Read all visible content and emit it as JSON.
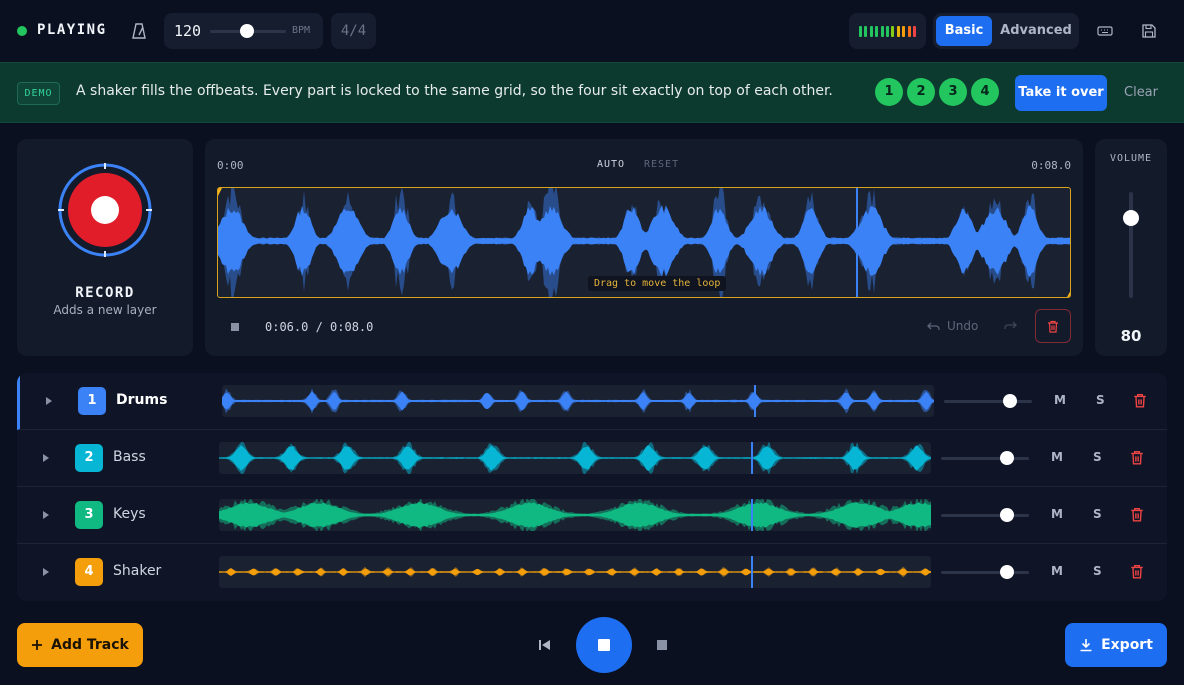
{
  "app": {
    "status": "PLAYING",
    "bpm": "120",
    "bpm_unit": "BPM",
    "bpm_value": 120,
    "time_signature": "4/4",
    "modes": {
      "basic": "Basic",
      "advanced": "Advanced",
      "selected": "basic"
    }
  },
  "demo": {
    "tag": "DEMO",
    "message": "A shaker fills the offbeats. Every part is locked to the same grid, so the four sit exactly on top of each other.",
    "steps": [
      "1",
      "2",
      "3",
      "4"
    ],
    "take_over_label": "Take it over",
    "clear_label": "Clear"
  },
  "recorder": {
    "title": "RECORD",
    "subtitle": "Adds a new layer"
  },
  "loop": {
    "start_time": "0:00",
    "end_time": "0:08.0",
    "auto_label": "AUTO",
    "reset_label": "RESET",
    "hint": "Drag to move the loop",
    "position_text": "0:06.0 / 0:08.0",
    "undo_label": "Undo",
    "playhead_fraction": 0.75
  },
  "volume": {
    "label": "VOLUME",
    "value": "80",
    "level": 0.8
  },
  "tracks": [
    {
      "number": "1",
      "name": "Drums",
      "color": "#3b82f6",
      "selected": true,
      "mute": "M",
      "solo": "S",
      "volume": 0.8
    },
    {
      "number": "2",
      "name": "Bass",
      "color": "#06b6d4",
      "selected": false,
      "mute": "M",
      "solo": "S",
      "volume": 0.8
    },
    {
      "number": "3",
      "name": "Keys",
      "color": "#10b981",
      "selected": false,
      "mute": "M",
      "solo": "S",
      "volume": 0.8
    },
    {
      "number": "4",
      "name": "Shaker",
      "color": "#f59e0b",
      "selected": false,
      "mute": "M",
      "solo": "S",
      "volume": 0.8
    }
  ],
  "bottom": {
    "add_track_label": "Add Track",
    "export_label": "Export"
  },
  "colors": {
    "accent": "#1d6ef0",
    "recording": "#e11d2a",
    "playing": "#22c55e",
    "loop_border": "#d9a41b"
  }
}
